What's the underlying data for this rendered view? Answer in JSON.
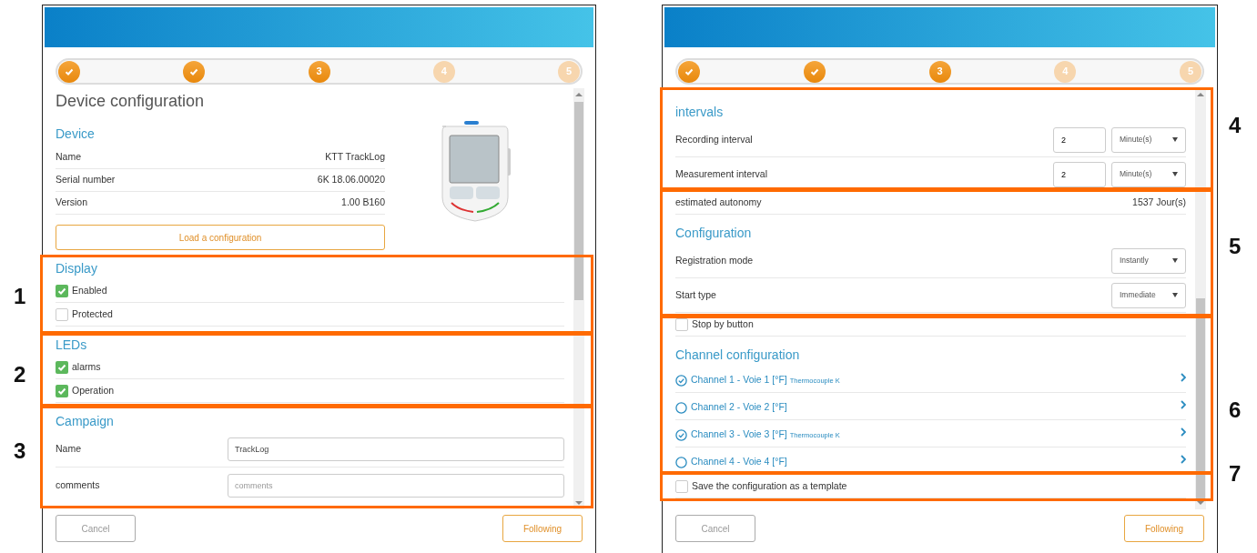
{
  "panels": [
    {
      "steps": [
        {
          "done": true,
          "current": false
        },
        {
          "done": true,
          "current": false
        },
        {
          "label": "3",
          "done": false,
          "current": true
        },
        {
          "label": "4",
          "done": false,
          "current": false
        },
        {
          "label": "5",
          "done": false,
          "current": false
        }
      ],
      "title": "Device configuration",
      "device": {
        "heading": "Device",
        "rows": [
          {
            "label": "Name",
            "value": "KTT TrackLog"
          },
          {
            "label": "Serial number",
            "value": "6K 18.06.00020"
          },
          {
            "label": "Version",
            "value": "1.00 B160"
          }
        ],
        "button": "Load a configuration"
      },
      "blocks": [
        {
          "kind": "heading",
          "text": "Display"
        },
        {
          "kind": "checkbox",
          "label": "Enabled",
          "checked": true
        },
        {
          "kind": "checkbox",
          "label": "Protected",
          "checked": false
        },
        {
          "kind": "heading",
          "text": "LEDs"
        },
        {
          "kind": "checkbox",
          "label": "alarms",
          "checked": true
        },
        {
          "kind": "checkbox",
          "label": "Operation",
          "checked": true
        },
        {
          "kind": "heading",
          "text": "Campaign"
        },
        {
          "kind": "input",
          "label": "Name",
          "value": "TrackLog"
        },
        {
          "kind": "input",
          "label": "comments",
          "placeholder": "comments"
        }
      ],
      "footer": {
        "cancel": "Cancel",
        "next": "Following"
      }
    },
    {
      "steps": [
        {
          "done": true,
          "current": false
        },
        {
          "done": true,
          "current": false
        },
        {
          "label": "3",
          "done": false,
          "current": true
        },
        {
          "label": "4",
          "done": false,
          "current": false
        },
        {
          "label": "5",
          "done": false,
          "current": false
        }
      ],
      "blocks": [
        {
          "kind": "heading",
          "text": "intervals"
        },
        {
          "kind": "interval",
          "label": "Recording interval",
          "value": "2",
          "unit": "Minute(s)"
        },
        {
          "kind": "interval",
          "label": "Measurement interval",
          "value": "2",
          "unit": "Minute(s)"
        },
        {
          "kind": "info",
          "label": "estimated autonomy",
          "value": "1537 Jour(s)"
        },
        {
          "kind": "heading",
          "text": "Configuration"
        },
        {
          "kind": "select",
          "label": "Registration mode",
          "value": "Instantly"
        },
        {
          "kind": "select",
          "label": "Start type",
          "value": "Immediate"
        },
        {
          "kind": "checkbox",
          "label": "Stop by button",
          "checked": false
        },
        {
          "kind": "heading",
          "text": "Channel configuration"
        },
        {
          "kind": "channel",
          "label": "Channel 1 - Voie 1 [°F]",
          "note": "Thermocouple K",
          "checked": true
        },
        {
          "kind": "channel",
          "label": "Channel 2 - Voie 2 [°F]",
          "checked": false
        },
        {
          "kind": "channel",
          "label": "Channel 3 - Voie 3 [°F]",
          "note": "Thermocouple K",
          "checked": true
        },
        {
          "kind": "channel",
          "label": "Channel 4 - Voie 4 [°F]",
          "checked": false
        },
        {
          "kind": "checkbox",
          "label": "Save the configuration as a template",
          "checked": false
        }
      ],
      "footer": {
        "cancel": "Cancel",
        "next": "Following"
      }
    }
  ],
  "annotations": [
    {
      "label": "1"
    },
    {
      "label": "2"
    },
    {
      "label": "3"
    },
    {
      "label": "4"
    },
    {
      "label": "5"
    },
    {
      "label": "6"
    },
    {
      "label": "7"
    }
  ]
}
